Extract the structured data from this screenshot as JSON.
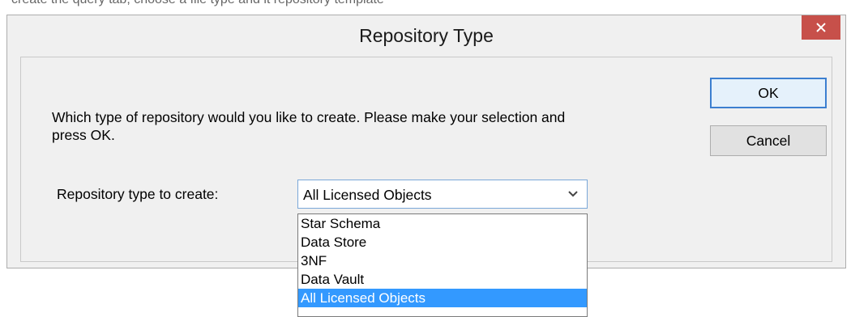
{
  "background_text": "create the query tab, choose a file type and it repository template",
  "window": {
    "title": "Repository Type",
    "close_icon": "close-icon"
  },
  "prompt": {
    "line1": "Which type of repository would you like to create. Please make your selection and",
    "line2": "press OK."
  },
  "buttons": {
    "ok_label": "OK",
    "cancel_label": "Cancel"
  },
  "field": {
    "label": "Repository type to create:",
    "selected": "All Licensed Objects",
    "options": [
      "Star Schema",
      "Data Store",
      "3NF",
      "Data Vault",
      "All Licensed Objects"
    ]
  },
  "colors": {
    "close_button": "#c7504a",
    "selection": "#3399ff",
    "focus_border": "#3c7fd0"
  }
}
